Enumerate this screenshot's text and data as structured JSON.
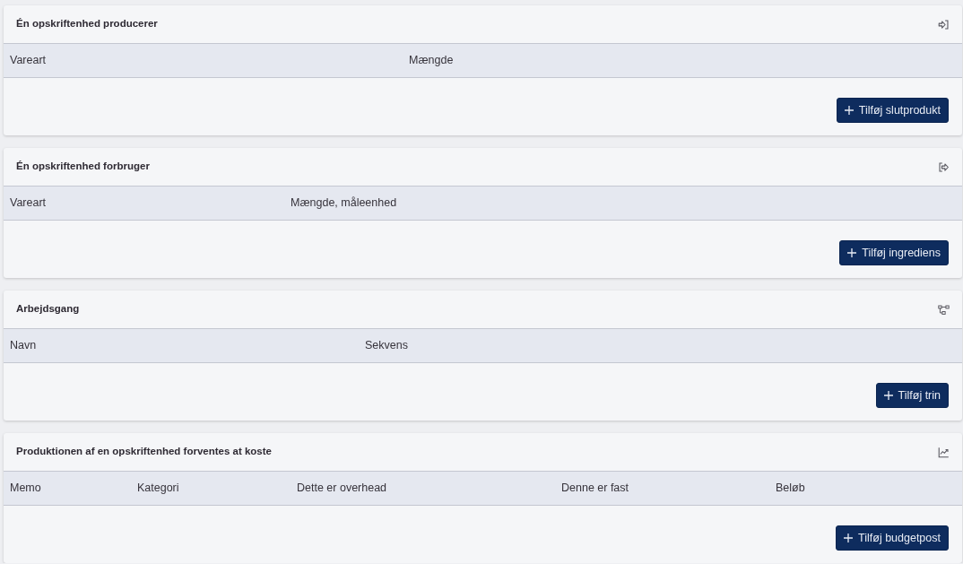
{
  "sections": [
    {
      "title": "Én opskriftenhed producerer",
      "columns": [
        "Vareart",
        "Mængde"
      ],
      "button": "Tilføj slutprodukt"
    },
    {
      "title": "Én opskriftenhed forbruger",
      "columns": [
        "Vareart",
        "Mængde, måleenhed"
      ],
      "button": "Tilføj ingrediens"
    },
    {
      "title": "Arbejdsgang",
      "columns": [
        "Navn",
        "Sekvens"
      ],
      "button": "Tilføj trin"
    },
    {
      "title": "Produktionen af en opskriftenhed forventes at koste",
      "columns": [
        "Memo",
        "Kategori",
        "Dette er overhead",
        "Denne er fast",
        "Beløb"
      ],
      "button": "Tilføj budgetpost"
    }
  ]
}
